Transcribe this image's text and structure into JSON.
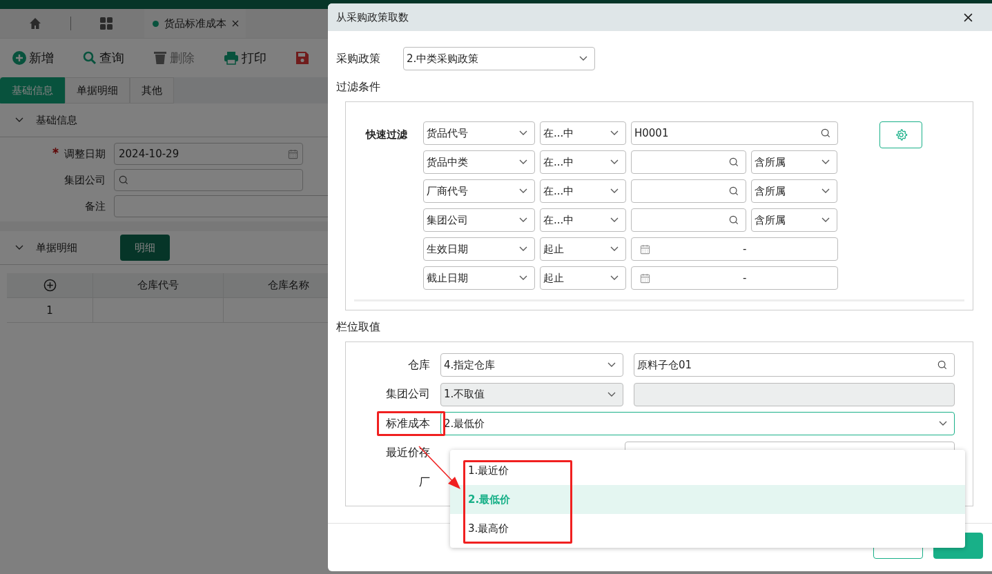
{
  "app": {
    "tabs": [
      {
        "kind": "home"
      },
      {
        "kind": "apps"
      },
      {
        "kind": "page",
        "label": "货品标准成本",
        "selected": true
      }
    ],
    "toolbar": [
      {
        "kind": "add",
        "label": "新增",
        "disabled": false
      },
      {
        "kind": "search",
        "label": "查询",
        "disabled": false
      },
      {
        "kind": "delete",
        "label": "删除",
        "disabled": true
      },
      {
        "kind": "print",
        "label": "打印",
        "disabled": false
      },
      {
        "kind": "save"
      }
    ],
    "form_tabs": [
      {
        "label": "基础信息",
        "selected": true
      },
      {
        "label": "单据明细",
        "selected": false
      },
      {
        "label": "其他",
        "selected": false
      }
    ],
    "basic_section": {
      "title": "基础信息",
      "expanded": true,
      "fields": [
        {
          "label": "调整日期",
          "required": true,
          "value": "2024-10-29",
          "kind": "date"
        },
        {
          "label": "集团公司",
          "required": false,
          "kind": "search"
        },
        {
          "label": "备注",
          "required": false,
          "kind": "text"
        }
      ]
    },
    "detail_section": {
      "title": "单据明细",
      "expanded": true,
      "button": "明细",
      "columns": [
        "仓库代号",
        "仓库名称"
      ],
      "rows": [
        {
          "number": "1"
        }
      ]
    }
  },
  "dialog": {
    "title": "从采购政策取数",
    "policy": {
      "label": "采购政策",
      "value": "2.中类采购政策"
    },
    "filter_title": "过滤条件",
    "quick_filter": {
      "label": "快速过滤",
      "rows": [
        {
          "field": "货品代号",
          "operator": "在...中",
          "kind": "search",
          "value": "H0001"
        },
        {
          "field": "货品中类",
          "operator": "在...中",
          "kind": "search",
          "scope": "含所属"
        },
        {
          "field": "厂商代号",
          "operator": "在...中",
          "kind": "search",
          "scope": "含所属"
        },
        {
          "field": "集团公司",
          "operator": "在...中",
          "kind": "search",
          "scope": "含所属"
        },
        {
          "field": "生效日期",
          "operator": "起止",
          "kind": "date_range",
          "separator": "-"
        },
        {
          "field": "截止日期",
          "operator": "起止",
          "kind": "date_range",
          "separator": "-"
        }
      ]
    },
    "columns_title": "栏位取值",
    "column_rows": [
      {
        "label": "仓库",
        "kind": "pair",
        "value": "4.指定仓库",
        "disabled": false,
        "extra": "原料子仓01",
        "extra_disabled": false
      },
      {
        "label": "集团公司",
        "kind": "pair",
        "value": "1.不取值",
        "disabled": true,
        "extra_disabled": true
      },
      {
        "label": "标准成本",
        "kind": "single",
        "value": "2.最低价",
        "disabled": false,
        "open": true,
        "highlighted": true
      },
      {
        "label": "最近价存",
        "kind": "covered"
      },
      {
        "label": "厂",
        "kind": "label"
      }
    ],
    "dropdown": [
      {
        "label": "1.最近价",
        "selected": false
      },
      {
        "label": "2.最低价",
        "selected": true
      },
      {
        "label": "3.最高价",
        "selected": false
      }
    ],
    "dropdown_highlighted": true,
    "buttons": [
      {
        "kind": "secondary"
      },
      {
        "kind": "primary"
      }
    ]
  }
}
